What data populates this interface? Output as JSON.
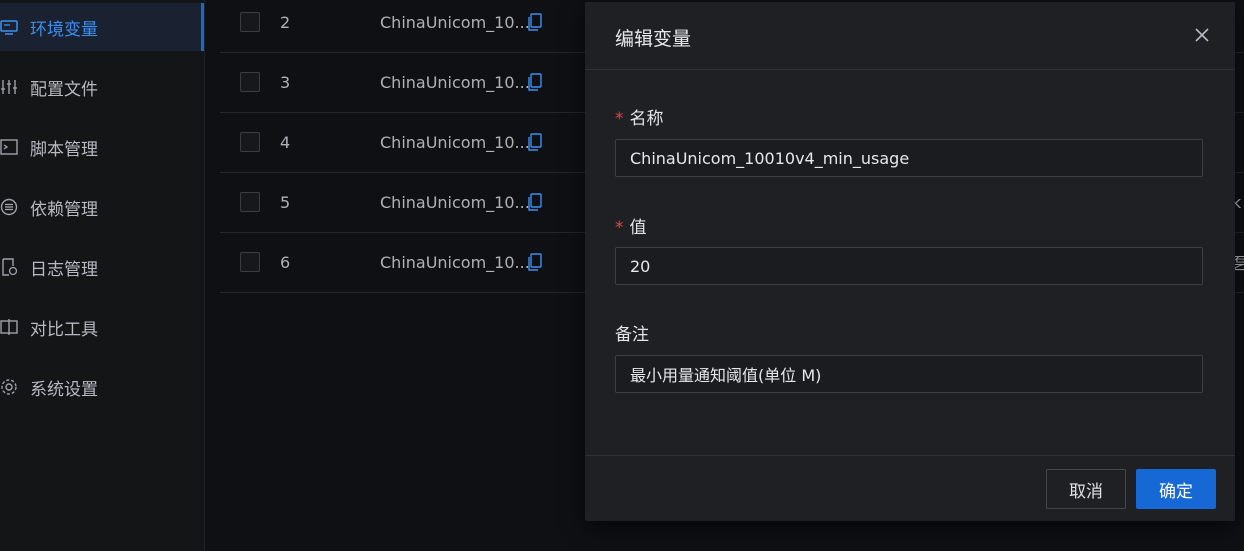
{
  "sidebar": {
    "items": [
      {
        "label": "环境变量",
        "icon": "monitor-icon",
        "active": true
      },
      {
        "label": "配置文件",
        "icon": "sliders-icon"
      },
      {
        "label": "脚本管理",
        "icon": "terminal-icon"
      },
      {
        "label": "依赖管理",
        "icon": "list-circle-icon"
      },
      {
        "label": "日志管理",
        "icon": "log-file-icon"
      },
      {
        "label": "对比工具",
        "icon": "diff-icon"
      },
      {
        "label": "系统设置",
        "icon": "gear-icon"
      }
    ]
  },
  "table": {
    "rows": [
      {
        "num": "2",
        "name": "ChinaUnicom_10..."
      },
      {
        "num": "3",
        "name": "ChinaUnicom_10..."
      },
      {
        "num": "4",
        "name": "ChinaUnicom_10..."
      },
      {
        "num": "5",
        "name": "ChinaUnicom_10...",
        "edge": "ĸ"
      },
      {
        "num": "6",
        "name": "ChinaUnicom_10...",
        "edge": "乭"
      }
    ]
  },
  "modal": {
    "title": "编辑变量",
    "name_label": "名称",
    "name_value": "ChinaUnicom_10010v4_min_usage",
    "value_label": "值",
    "value_value": "20",
    "remark_label": "备注",
    "remark_value": "最小用量通知阈值(单位 M)",
    "cancel_label": "取消",
    "ok_label": "确定",
    "required_mark": "*"
  },
  "colors": {
    "accent": "#1669d4",
    "required": "#e0483e"
  }
}
